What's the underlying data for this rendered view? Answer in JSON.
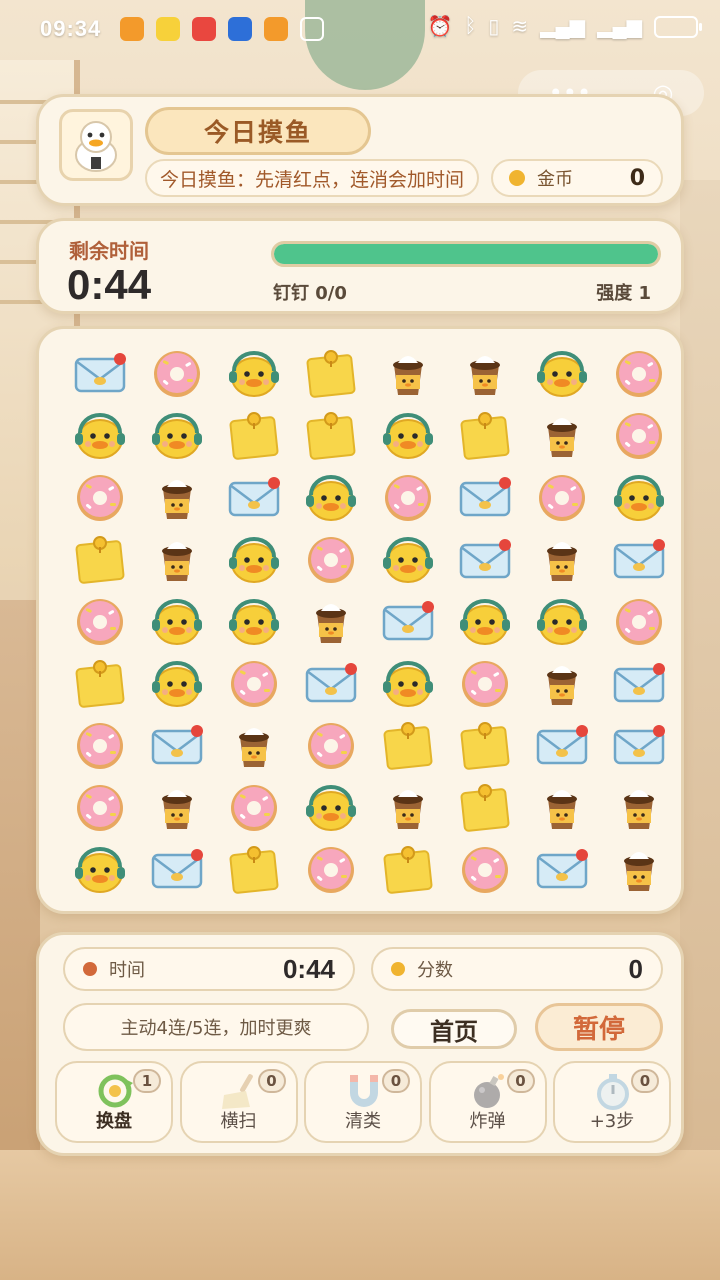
{
  "status_bar": {
    "time": "09:34"
  },
  "header": {
    "title": "今日摸鱼",
    "tip": "今日摸鱼：先清红点，连消会加时间",
    "coin_label": "金币",
    "coin_value": "0"
  },
  "timer": {
    "label": "剩余时间",
    "value": "0:44",
    "progress": 1.0,
    "dingding": "钉钉 0/0",
    "strength": "强度 1"
  },
  "board": {
    "tiles": [
      [
        "envelope",
        "donut",
        "duck",
        "note",
        "coffee",
        "coffee",
        "duck",
        "donut"
      ],
      [
        "duck",
        "duck",
        "note",
        "note",
        "duck",
        "note",
        "coffee",
        "donut"
      ],
      [
        "donut",
        "coffee",
        "envelope",
        "duck",
        "donut",
        "envelope",
        "donut",
        "duck"
      ],
      [
        "note",
        "coffee",
        "duck",
        "donut",
        "duck",
        "envelope",
        "coffee",
        "envelope"
      ],
      [
        "donut",
        "duck",
        "duck",
        "coffee",
        "envelope",
        "duck",
        "duck",
        "donut"
      ],
      [
        "note",
        "duck",
        "donut",
        "envelope",
        "duck",
        "donut",
        "coffee",
        "envelope"
      ],
      [
        "donut",
        "envelope",
        "coffee",
        "donut",
        "note",
        "note",
        "envelope",
        "envelope"
      ],
      [
        "donut",
        "coffee",
        "donut",
        "duck",
        "coffee",
        "note",
        "coffee",
        "coffee"
      ],
      [
        "duck",
        "envelope",
        "note",
        "donut",
        "note",
        "donut",
        "envelope",
        "coffee"
      ]
    ]
  },
  "stats": {
    "time_label": "时间",
    "time_value": "0:44",
    "score_label": "分数",
    "score_value": "0"
  },
  "controls": {
    "hint": "主动4连/5连，加时更爽",
    "home_label": "首页",
    "pause_label": "暂停"
  },
  "tools": [
    {
      "label": "换盘",
      "count": "1",
      "icon": "shuffle-icon",
      "enabled": true
    },
    {
      "label": "横扫",
      "count": "0",
      "icon": "broom-icon",
      "enabled": false
    },
    {
      "label": "清类",
      "count": "0",
      "icon": "magnet-icon",
      "enabled": false
    },
    {
      "label": "炸弹",
      "count": "0",
      "icon": "bomb-icon",
      "enabled": false
    },
    {
      "label": "+3步",
      "count": "0",
      "icon": "stopwatch-icon",
      "enabled": false
    }
  ],
  "colors": {
    "accent_green": "#4fc48c",
    "pause_orange": "#d2693a",
    "title_brown": "#9a5a26"
  }
}
